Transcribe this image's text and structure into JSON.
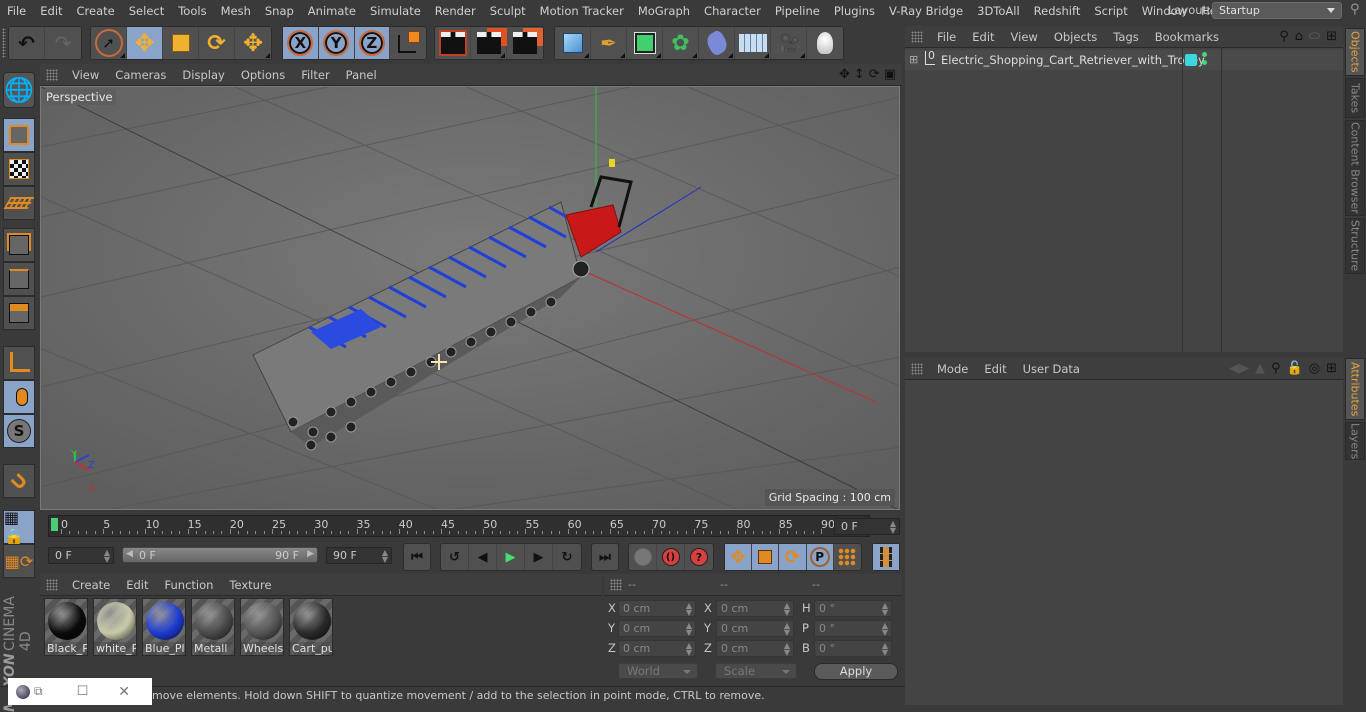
{
  "menubar": {
    "items": [
      "File",
      "Edit",
      "Create",
      "Select",
      "Tools",
      "Mesh",
      "Snap",
      "Animate",
      "Simulate",
      "Render",
      "Sculpt",
      "Motion Tracker",
      "MoGraph",
      "Character",
      "Pipeline",
      "Plugins",
      "V-Ray Bridge",
      "3DToAll",
      "Redshift",
      "Script",
      "Window",
      "Help"
    ],
    "layout_label": "Layout:",
    "layout_value": "Startup"
  },
  "toolbar": {
    "axis_x": "X",
    "axis_y": "Y",
    "axis_z": "Z"
  },
  "viewport": {
    "menu": [
      "View",
      "Cameras",
      "Display",
      "Options",
      "Filter",
      "Panel"
    ],
    "camera_label": "Perspective",
    "grid_spacing": "Grid Spacing : 100 cm",
    "axis_labels": {
      "x": "X",
      "y": "Y",
      "z": "Z"
    }
  },
  "timeline": {
    "ticks": [
      "0",
      "5",
      "10",
      "15",
      "20",
      "25",
      "30",
      "35",
      "40",
      "45",
      "50",
      "55",
      "60",
      "65",
      "70",
      "75",
      "80",
      "85",
      "90"
    ],
    "current_frame": "0 F",
    "start_field": "0 F",
    "range_start": "0 F",
    "range_end": "90 F",
    "end_field": "90 F"
  },
  "materials": {
    "menu": [
      "Create",
      "Edit",
      "Function",
      "Texture"
    ],
    "items": [
      {
        "label": "Black_Pl",
        "color": "#0a0a0a"
      },
      {
        "label": "white_P",
        "color": "#c9c9a8"
      },
      {
        "label": "Blue_Pla",
        "color": "#1c3bd0"
      },
      {
        "label": "Metall",
        "color": "#4a4a4a"
      },
      {
        "label": "Wheels",
        "color": "#555555"
      },
      {
        "label": "Cart_pu",
        "color": "#2a2a2a"
      }
    ]
  },
  "coordinates": {
    "header": [
      "--",
      "--",
      "--"
    ],
    "rows": [
      {
        "l1": "X",
        "v1": "0 cm",
        "l2": "X",
        "v2": "0 cm",
        "l3": "H",
        "v3": "0 °"
      },
      {
        "l1": "Y",
        "v1": "0 cm",
        "l2": "Y",
        "v2": "0 cm",
        "l3": "P",
        "v3": "0 °"
      },
      {
        "l1": "Z",
        "v1": "0 cm",
        "l2": "Z",
        "v2": "0 cm",
        "l3": "B",
        "v3": "0 °"
      }
    ],
    "space_select": "World",
    "mode_select": "Scale",
    "apply_label": "Apply"
  },
  "status": {
    "text": "move elements. Hold down SHIFT to quantize movement / add to the selection in point mode, CTRL to remove."
  },
  "objects_panel": {
    "menu": [
      "File",
      "Edit",
      "View",
      "Objects",
      "Tags",
      "Bookmarks"
    ],
    "objects": [
      {
        "name": "Electric_Shopping_Cart_Retriever_with_Trolley",
        "layer_color": "#3dd6e0"
      }
    ]
  },
  "attributes_panel": {
    "menu": [
      "Mode",
      "Edit",
      "User Data"
    ]
  },
  "side_tabs": {
    "top": [
      "Objects",
      "Takes",
      "Content Browser",
      "Structure"
    ],
    "bottom": [
      "Attributes",
      "Layers"
    ]
  },
  "branding": {
    "vendor": "MAXON",
    "product": "CINEMA 4D"
  },
  "colors": {
    "accent_active": "#8aa3c8",
    "tab_active_text": "#e8a23c",
    "timeline_cursor": "#4ccc74"
  }
}
